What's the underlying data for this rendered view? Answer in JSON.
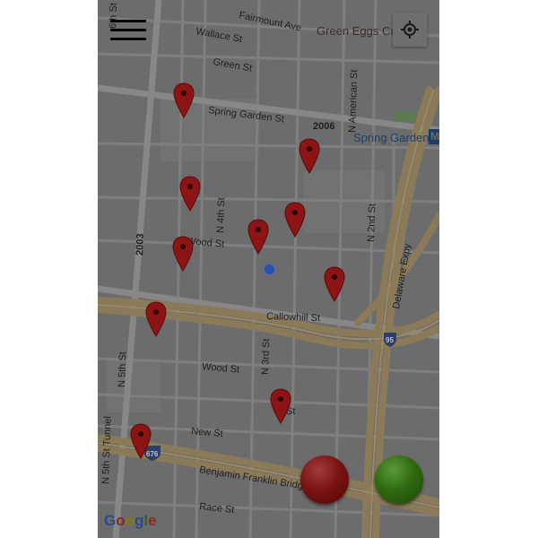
{
  "screen": {
    "menu_icon": "hamburger-menu-icon",
    "locate_icon": "my-location-icon"
  },
  "map": {
    "streets": {
      "fairmount": "Fairmount Ave",
      "wallace": "Wallace St",
      "green": "Green St",
      "spring_garden": "Spring Garden St",
      "wood": "Wood St",
      "callowhill": "Callowhill St",
      "wood_lower": "Wood St",
      "new": "New St",
      "benjamin_franklin": "Benjamin Franklin Bridge",
      "race": "Race St",
      "n_4th": "N 4th St",
      "n_3rd": "N 3rd St",
      "n_2nd": "N 2nd St",
      "n_american": "N American St",
      "n_5th": "N 5th St",
      "n_5th_tunnel": "N 5th St Tunnel",
      "delaware": "Delaware Expy",
      "st_short": "St",
      "n_6th_partial": "6th St"
    },
    "route_numbers": {
      "r2003": "2003",
      "r2006": "2006",
      "i95": "95",
      "i676": "676"
    },
    "poi": {
      "green_eggs": "Green Eggs Ca",
      "spring_garden_station": "Spring Garden",
      "metro_badge": "M"
    },
    "attribution": "Google"
  },
  "colors": {
    "pin": "#8c1414",
    "stop_button": "#7a1313",
    "go_button": "#2f6a10",
    "user_dot": "#2b50a8",
    "highway": "#8a7a58"
  },
  "buttons": {
    "stop": "red-stop-button",
    "go": "green-go-button"
  }
}
